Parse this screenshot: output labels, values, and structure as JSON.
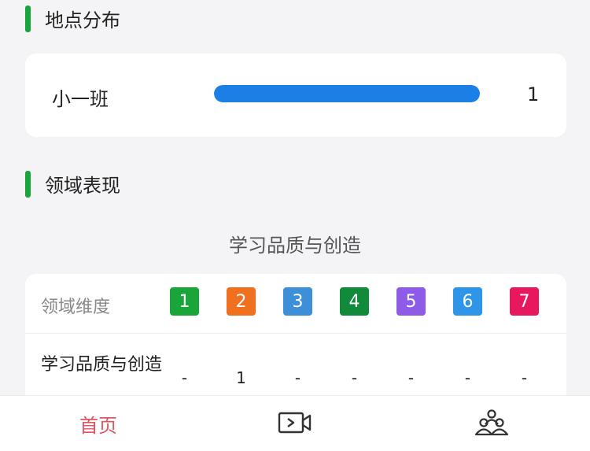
{
  "location_section": {
    "title": "地点分布",
    "rows": [
      {
        "name": "小一班",
        "count": "1",
        "fill_fraction": 1.0
      }
    ],
    "bar_color": "#1b7fe6"
  },
  "domain_section": {
    "title": "领域表现",
    "subtitle": "学习品质与创造",
    "header_label": "领域维度",
    "dimensions": [
      {
        "label": "1",
        "color": "#1aa53a"
      },
      {
        "label": "2",
        "color": "#f07020"
      },
      {
        "label": "3",
        "color": "#3d8fd8"
      },
      {
        "label": "4",
        "color": "#118a3a"
      },
      {
        "label": "5",
        "color": "#8e5ae8"
      },
      {
        "label": "6",
        "color": "#2f95e8"
      },
      {
        "label": "7",
        "color": "#e8185e"
      }
    ],
    "rows": [
      {
        "label": "学习品质与创造",
        "values": [
          "-",
          "1",
          "-",
          "-",
          "-",
          "-",
          "-"
        ]
      }
    ]
  },
  "tabbar": {
    "items": [
      {
        "label": "首页",
        "icon": "home-label",
        "active": true
      },
      {
        "label": "",
        "icon": "video-icon",
        "active": false
      },
      {
        "label": "",
        "icon": "group-icon",
        "active": false
      }
    ],
    "active_color": "#e0555f"
  },
  "accent_color": "#1aa53a"
}
